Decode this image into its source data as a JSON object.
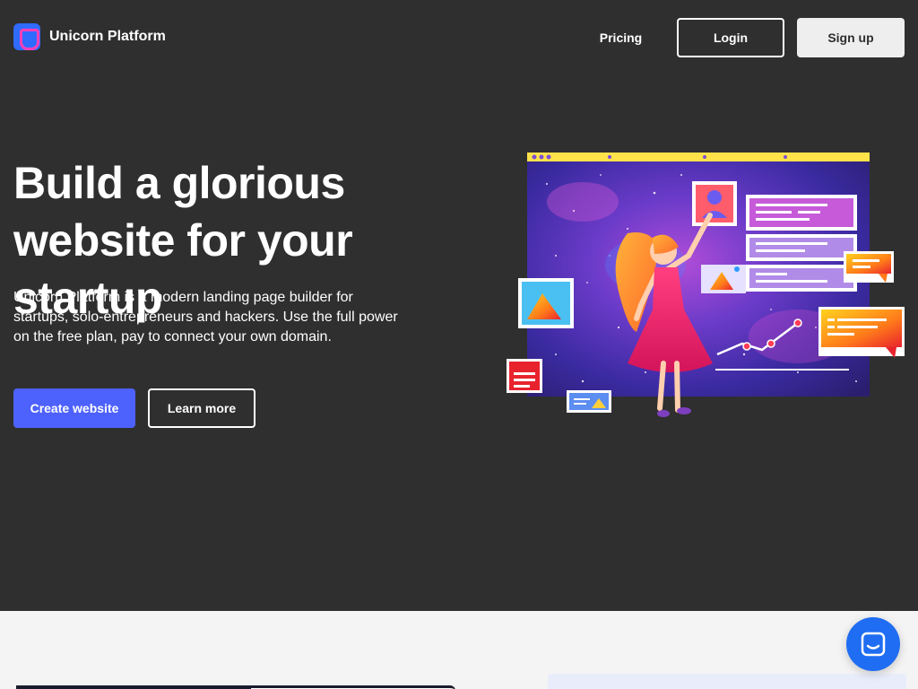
{
  "header": {
    "brand": "Unicorn Platform",
    "nav_pricing": "Pricing",
    "login_label": "Login",
    "signup_label": "Sign up"
  },
  "hero": {
    "headline": "Build a glorious website for your startup",
    "subtext": "Unicorn Platform is a modern landing page builder for startups, solo-entrepreneurs and hackers. Use the full power on the free plan, pay to connect your own domain.",
    "primary_cta": "Create website",
    "secondary_cta": "Learn more"
  },
  "icons": {
    "logo": "unicorn-logo-icon",
    "chat": "chat-bubble-icon"
  },
  "colors": {
    "hero_bg": "#2f2f2f",
    "accent": "#4d61fc",
    "chat": "#1f6df2",
    "page_bg": "#f4f4f4"
  }
}
